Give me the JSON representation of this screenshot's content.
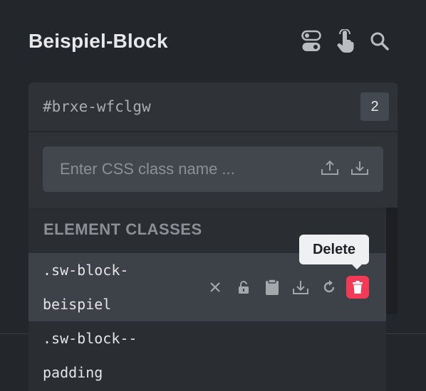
{
  "header": {
    "title": "Beispiel-Block",
    "icons": [
      "toggle-icon",
      "pointer-hand-icon",
      "search-icon"
    ]
  },
  "element": {
    "id": "#brxe-wfclgw",
    "class_count": "2"
  },
  "class_input": {
    "placeholder": "Enter CSS class name ...",
    "value": "",
    "icons": [
      "upload-icon",
      "download-icon"
    ]
  },
  "classes_section": {
    "title": "ELEMENT CLASSES",
    "items": [
      {
        "name_line1": ".sw-block-",
        "name_line2": "beispiel",
        "active": true
      },
      {
        "name_line1": ".sw-block--",
        "name_line2": "padding",
        "active": false
      }
    ],
    "row_action_icons": [
      "remove-icon",
      "lock-icon",
      "clipboard-icon",
      "download-icon",
      "refresh-icon",
      "delete-icon"
    ]
  },
  "tooltip": {
    "text": "Delete"
  },
  "colors": {
    "background": "#23262b",
    "panel": "#2f3338",
    "active_row": "#3c4248",
    "delete_accent": "#f23957"
  }
}
